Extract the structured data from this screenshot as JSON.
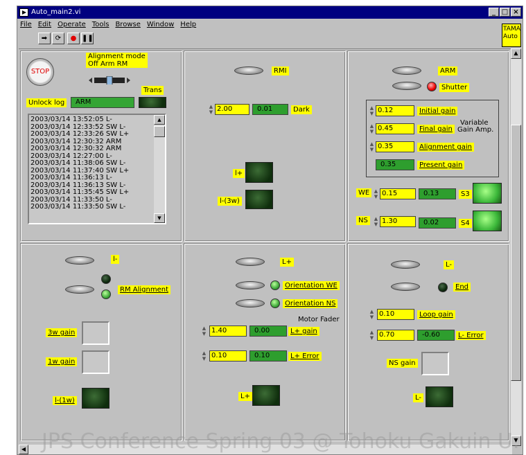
{
  "window": {
    "title": "Auto_main2.vi",
    "min": "_",
    "max": "□",
    "close": "×"
  },
  "menu": [
    "File",
    "Edit",
    "Operate",
    "Tools",
    "Browse",
    "Window",
    "Help"
  ],
  "tama": "TAMA\nAuto",
  "toolbar": {
    "run": "➡",
    "cont": "⟳",
    "abort": "●",
    "pause": "❚❚"
  },
  "p1": {
    "stop": "STOP",
    "align_mode": "Alignment mode",
    "align_opts": "Off  Arm  RM",
    "trans": "Trans",
    "unlock_log": "Unlock log",
    "arm_value": "ARM",
    "log": [
      "2003/03/14 13:52:05 L-",
      "2003/03/14 12:33:52 SW L-",
      "2003/03/14 12:33:26 SW L+",
      "2003/03/14 12:30:32 ARM",
      "2003/03/14 12:30:32 ARM",
      "2003/03/14 12:27:00 L-",
      "2003/03/14 11:38:06 SW L-",
      "2003/03/14 11:37:40 SW L+",
      "2003/03/14 11:36:13 L-",
      "2003/03/14 11:36:13 SW L-",
      "2003/03/14 11:35:45 SW L+",
      "2003/03/14 11:33:50 L-",
      "2003/03/14 11:33:50 SW L-"
    ]
  },
  "p2": {
    "rmi": "RMI",
    "dark_val": "2.00",
    "dark_ind": "0.01",
    "dark": "Dark",
    "lplus": "l+",
    "lminus3w": "l-(3w)"
  },
  "p3": {
    "arm": "ARM",
    "shutter": "Shutter",
    "initial_val": "0.12",
    "initial": "Initial gain",
    "final_val": "0.45",
    "final": "Final gain",
    "variable": "Variable",
    "gain_amp": "Gain Amp.",
    "align_val": "0.35",
    "align": "Alignment gain",
    "present_val": "0.35",
    "present": "Present gain",
    "we": "WE",
    "we_val": "0.15",
    "we_ind": "0.13",
    "s3": "S3",
    "ns": "NS",
    "ns_val": "1.30",
    "ns_ind": "0.02",
    "s4": "S4"
  },
  "p4": {
    "lminus": "l-",
    "rm_align": "RM Alignment",
    "g3w": "3w gain",
    "g1w": "1w gain",
    "l1w": "l-(1w)"
  },
  "p5": {
    "lplus": "L+",
    "orient_we": "Orientation WE",
    "orient_ns": "Orientation NS",
    "motor_fader": "Motor Fader",
    "gain_val": "1.40",
    "gain_ind": "0.00",
    "lplus_gain": "L+ gain",
    "err_val": "0.10",
    "err_ind": "0.10",
    "lplus_error": "L+ Error",
    "lplus_btn": "L+"
  },
  "p6": {
    "lminus": "L-",
    "end": "End",
    "loop_val": "0.10",
    "loop": "Loop gain",
    "err_val": "0.70",
    "err_ind": "-0.60",
    "lminus_error": "L- Error",
    "ns_gain": "NS gain",
    "lminus_btn": "L-"
  },
  "watermark": "JPS Conference Spring 03 @ Tohoku Gakuin U."
}
